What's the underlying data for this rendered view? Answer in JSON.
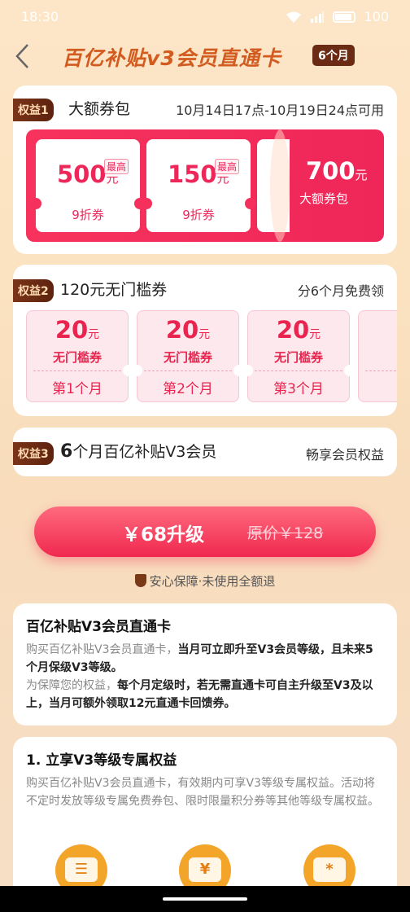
{
  "status": {
    "time": "18:30",
    "battery": "100"
  },
  "header": {
    "title": "百亿补贴v3会员直通卡",
    "badge": "6个月"
  },
  "benefit1": {
    "tag": "权益1",
    "title": "大额券包",
    "validity": "10月14日17点-10月19日24点可用",
    "coupons": [
      {
        "amount": "500",
        "unit": "元",
        "max_label": "最高",
        "kind": "9折券"
      },
      {
        "amount": "150",
        "unit": "元",
        "max_label": "最高",
        "kind": "9折券"
      }
    ],
    "pack": {
      "amount": "700",
      "unit": "元",
      "label": "大额券包"
    }
  },
  "benefit2": {
    "tag": "权益2",
    "title": "120元无门槛券",
    "note": "分6个月免费领",
    "coupons": [
      {
        "amount": "20",
        "unit": "元",
        "kind": "无门槛券",
        "month": "第1个月"
      },
      {
        "amount": "20",
        "unit": "元",
        "kind": "无门槛券",
        "month": "第2个月"
      },
      {
        "amount": "20",
        "unit": "元",
        "kind": "无门槛券",
        "month": "第3个月"
      }
    ]
  },
  "benefit3": {
    "tag": "权益3",
    "title_num": "6",
    "title_rest": "个月百亿补贴V3会员",
    "note": "畅享会员权益"
  },
  "cta": {
    "price": "￥68升级",
    "original": "原价￥128"
  },
  "guarantee": "安心保障·未使用全额退",
  "info1": {
    "title": "百亿补贴V3会员直通卡",
    "p1_a": "购买百亿补贴V3会员直通卡，",
    "p1_b": "当月可立即升至V3会员等级，且未来5个月保级V3等级。",
    "p2_a": "为保障您的权益，",
    "p2_b": "每个月定级时，若无需直通卡可自主升级至V3及以上，当月可额外领取12元直通卡回馈券。"
  },
  "info2": {
    "title": "1. 立享V3等级专属权益",
    "body": "购买百亿补贴V3会员直通卡，有效期内可享V3等级专属权益。活动将不定时发放等级专属免费券包、限时限量积分券等其他等级专属权益。",
    "icons": [
      "☰",
      "¥",
      "*"
    ]
  }
}
